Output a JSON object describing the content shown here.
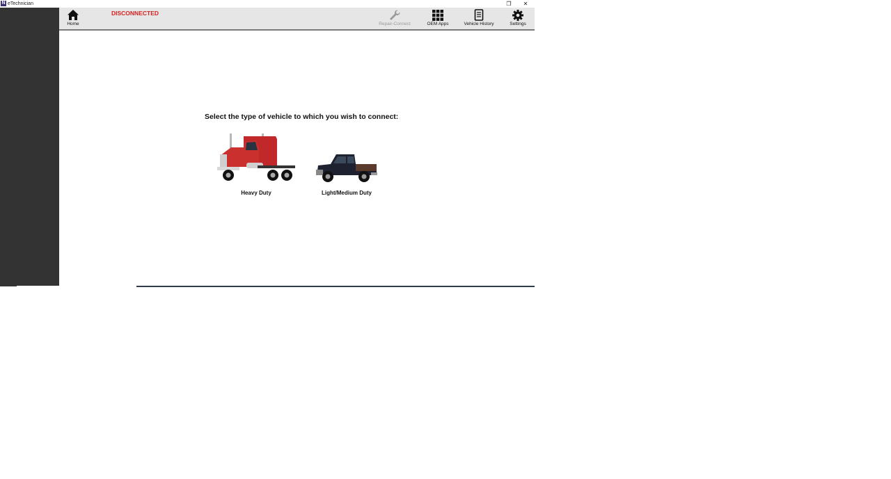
{
  "window": {
    "title": "eTechnician",
    "app_icon_letter": "N",
    "restore_symbol": "❐",
    "close_symbol": "✕"
  },
  "toolbar": {
    "status": "DISCONNECTED",
    "status_color": "#d42020",
    "items": [
      {
        "label": "Home",
        "icon": "home-icon",
        "enabled": true
      },
      {
        "label": "Repair-Connect",
        "icon": "wrench-icon",
        "enabled": false
      },
      {
        "label": "OEM Apps",
        "icon": "grid-icon",
        "enabled": true
      },
      {
        "label": "Vehicle History",
        "icon": "document-icon",
        "enabled": true
      },
      {
        "label": "Settings",
        "icon": "gear-icon",
        "enabled": true
      }
    ]
  },
  "main": {
    "prompt": "Select the type of vehicle to which you wish to connect:",
    "vehicles": [
      {
        "label": "Heavy Duty",
        "icon": "semi-truck-image",
        "color": "#c0282a"
      },
      {
        "label": "Light/Medium Duty",
        "icon": "pickup-truck-image",
        "color": "#1e2230"
      }
    ]
  }
}
